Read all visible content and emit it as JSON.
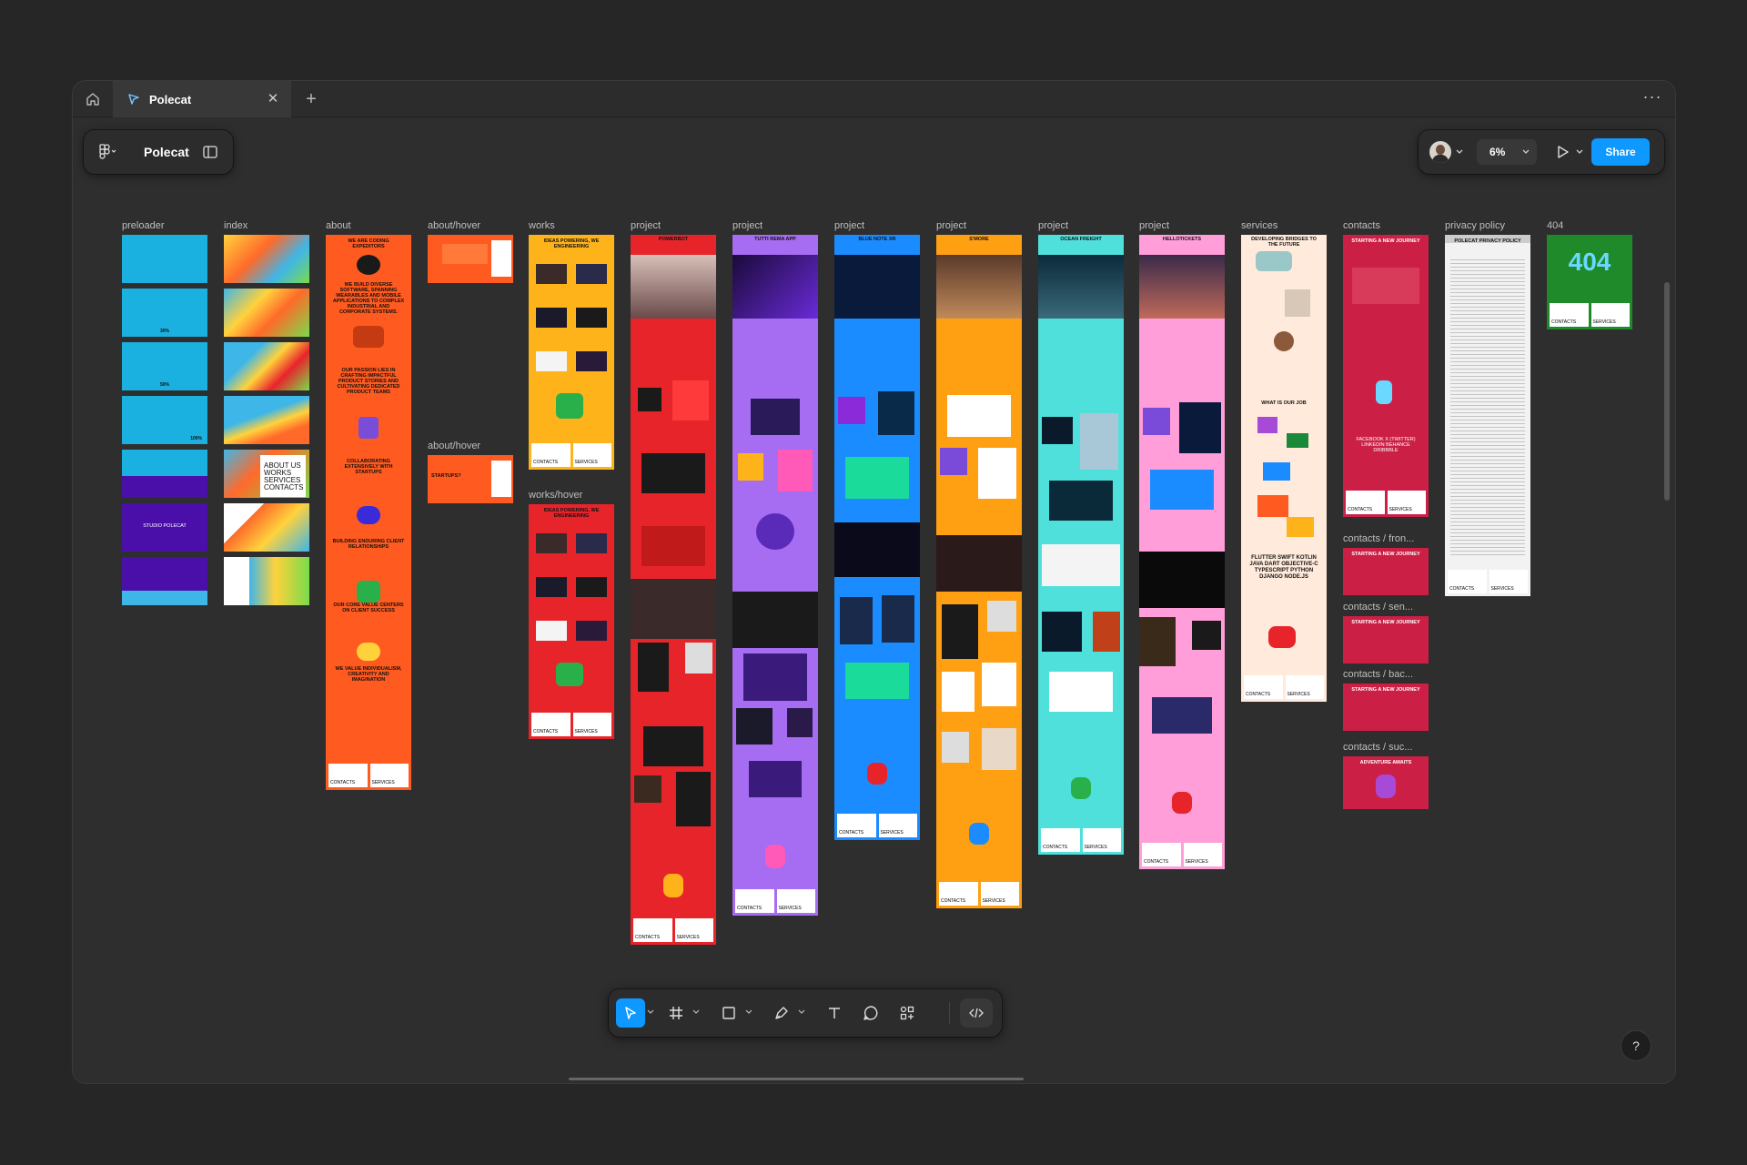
{
  "titlebar": {
    "tab_label": "Polecat",
    "more_label": "···"
  },
  "file_panel": {
    "name": "Polecat"
  },
  "right_panel": {
    "zoom": "6%",
    "share_label": "Share"
  },
  "frames": [
    {
      "label": "preloader",
      "color": "#1ab0e0"
    },
    {
      "label": "index",
      "color": "#3fb6e8"
    },
    {
      "label": "about",
      "color": "#ff5a1f"
    },
    {
      "label": "about/hover",
      "color": "#ff5a1f"
    },
    {
      "label": "about/hover",
      "color": "#ff5a1f"
    },
    {
      "label": "works",
      "color": "#ffb31a"
    },
    {
      "label": "works/hover",
      "color": "#e8242b"
    },
    {
      "label": "project",
      "color": "#e8242b"
    },
    {
      "label": "project",
      "color": "#a66cf2"
    },
    {
      "label": "project",
      "color": "#1a8cff"
    },
    {
      "label": "project",
      "color": "#ff9f12"
    },
    {
      "label": "project",
      "color": "#4fe0dc"
    },
    {
      "label": "project",
      "color": "#ff9ed8"
    },
    {
      "label": "services",
      "color": "#ffeadb"
    },
    {
      "label": "contacts",
      "color": "#cc1f45"
    },
    {
      "label": "contacts / fron...",
      "color": "#cc1f45"
    },
    {
      "label": "contacts / sen...",
      "color": "#cc1f45"
    },
    {
      "label": "contacts / bac...",
      "color": "#cc1f45"
    },
    {
      "label": "contacts / suc...",
      "color": "#cc1f45"
    },
    {
      "label": "privacy policy",
      "color": "#f2f2f2"
    },
    {
      "label": "404",
      "color": "#1e8a2a"
    }
  ],
  "frame_text": {
    "preloader_studio": "STUDIO POLECAT",
    "preloader_30": "30%",
    "preloader_50": "50%",
    "preloader_100": "100%",
    "index_menu": "ABOUT US WORKS SERVICES CONTACTS",
    "about_heading": "WE ARE CODING EXPEDITORS",
    "about_p1": "WE BUILD DIVERSE SOFTWARE, SPANNING WEARABLES AND MOBILE APPLICATIONS TO COMPLEX INDUSTRIAL AND CORPORATE SYSTEMS.",
    "about_p2": "OUR PASSION LIES IN CRAFTING IMPACTFUL PRODUCT STORIES AND CULTIVATING DEDICATED PRODUCT TEAMS",
    "about_p3": "COLLABORATING EXTENSIVELY WITH STARTUPS",
    "about_p4": "BUILDING ENDURING CLIENT RELATIONSHIPS",
    "about_p5": "OUR CORE VALUE CENTERS ON CLIENT SUCCESS",
    "about_p6": "WE VALUE INDIVIDUALISM, CREATIVITY AND IMAGINATION",
    "startups": "STARTUPS?",
    "works_heading": "IDEAS POWERING, WE ENGINEERING",
    "p_powerbot": "POWERBOT",
    "p_tuttirema": "TUTTI REMA APP",
    "p_bluenote": "BLUE NOTE XR",
    "p_smore": "S'MORE",
    "p_ocean": "OCEAN FREIGHT",
    "p_hello": "HELLOTICKETS",
    "services_heading": "DEVELOPING BRIDGES TO THE FUTURE",
    "services_job": "WHAT IS OUR JOB",
    "services_stack": "FLUTTER SWIFT KOTLIN JAVA DART OBJECTIVE-C TYPESCRIPT PYTHON DJANGO NODE.JS",
    "contacts_heading": "STARTING A NEW JOURNEY",
    "contacts_adventure": "ADVENTURE AWAITS",
    "contacts_social": "FACEBOOK X (TWITTER) LINKEDIN BEHANCE DRIBBBLE",
    "privacy_heading": "POLECAT PRIVACY POLICY",
    "page_404": "404",
    "footer_contacts": "CONTACTS",
    "footer_services": "SERVICES"
  },
  "toolbar": {
    "tools": [
      "move-tool",
      "frame-tool",
      "shape-tool",
      "pen-tool",
      "text-tool",
      "comment-tool",
      "actions-tool",
      "dev-mode-toggle"
    ]
  },
  "help_label": "?"
}
